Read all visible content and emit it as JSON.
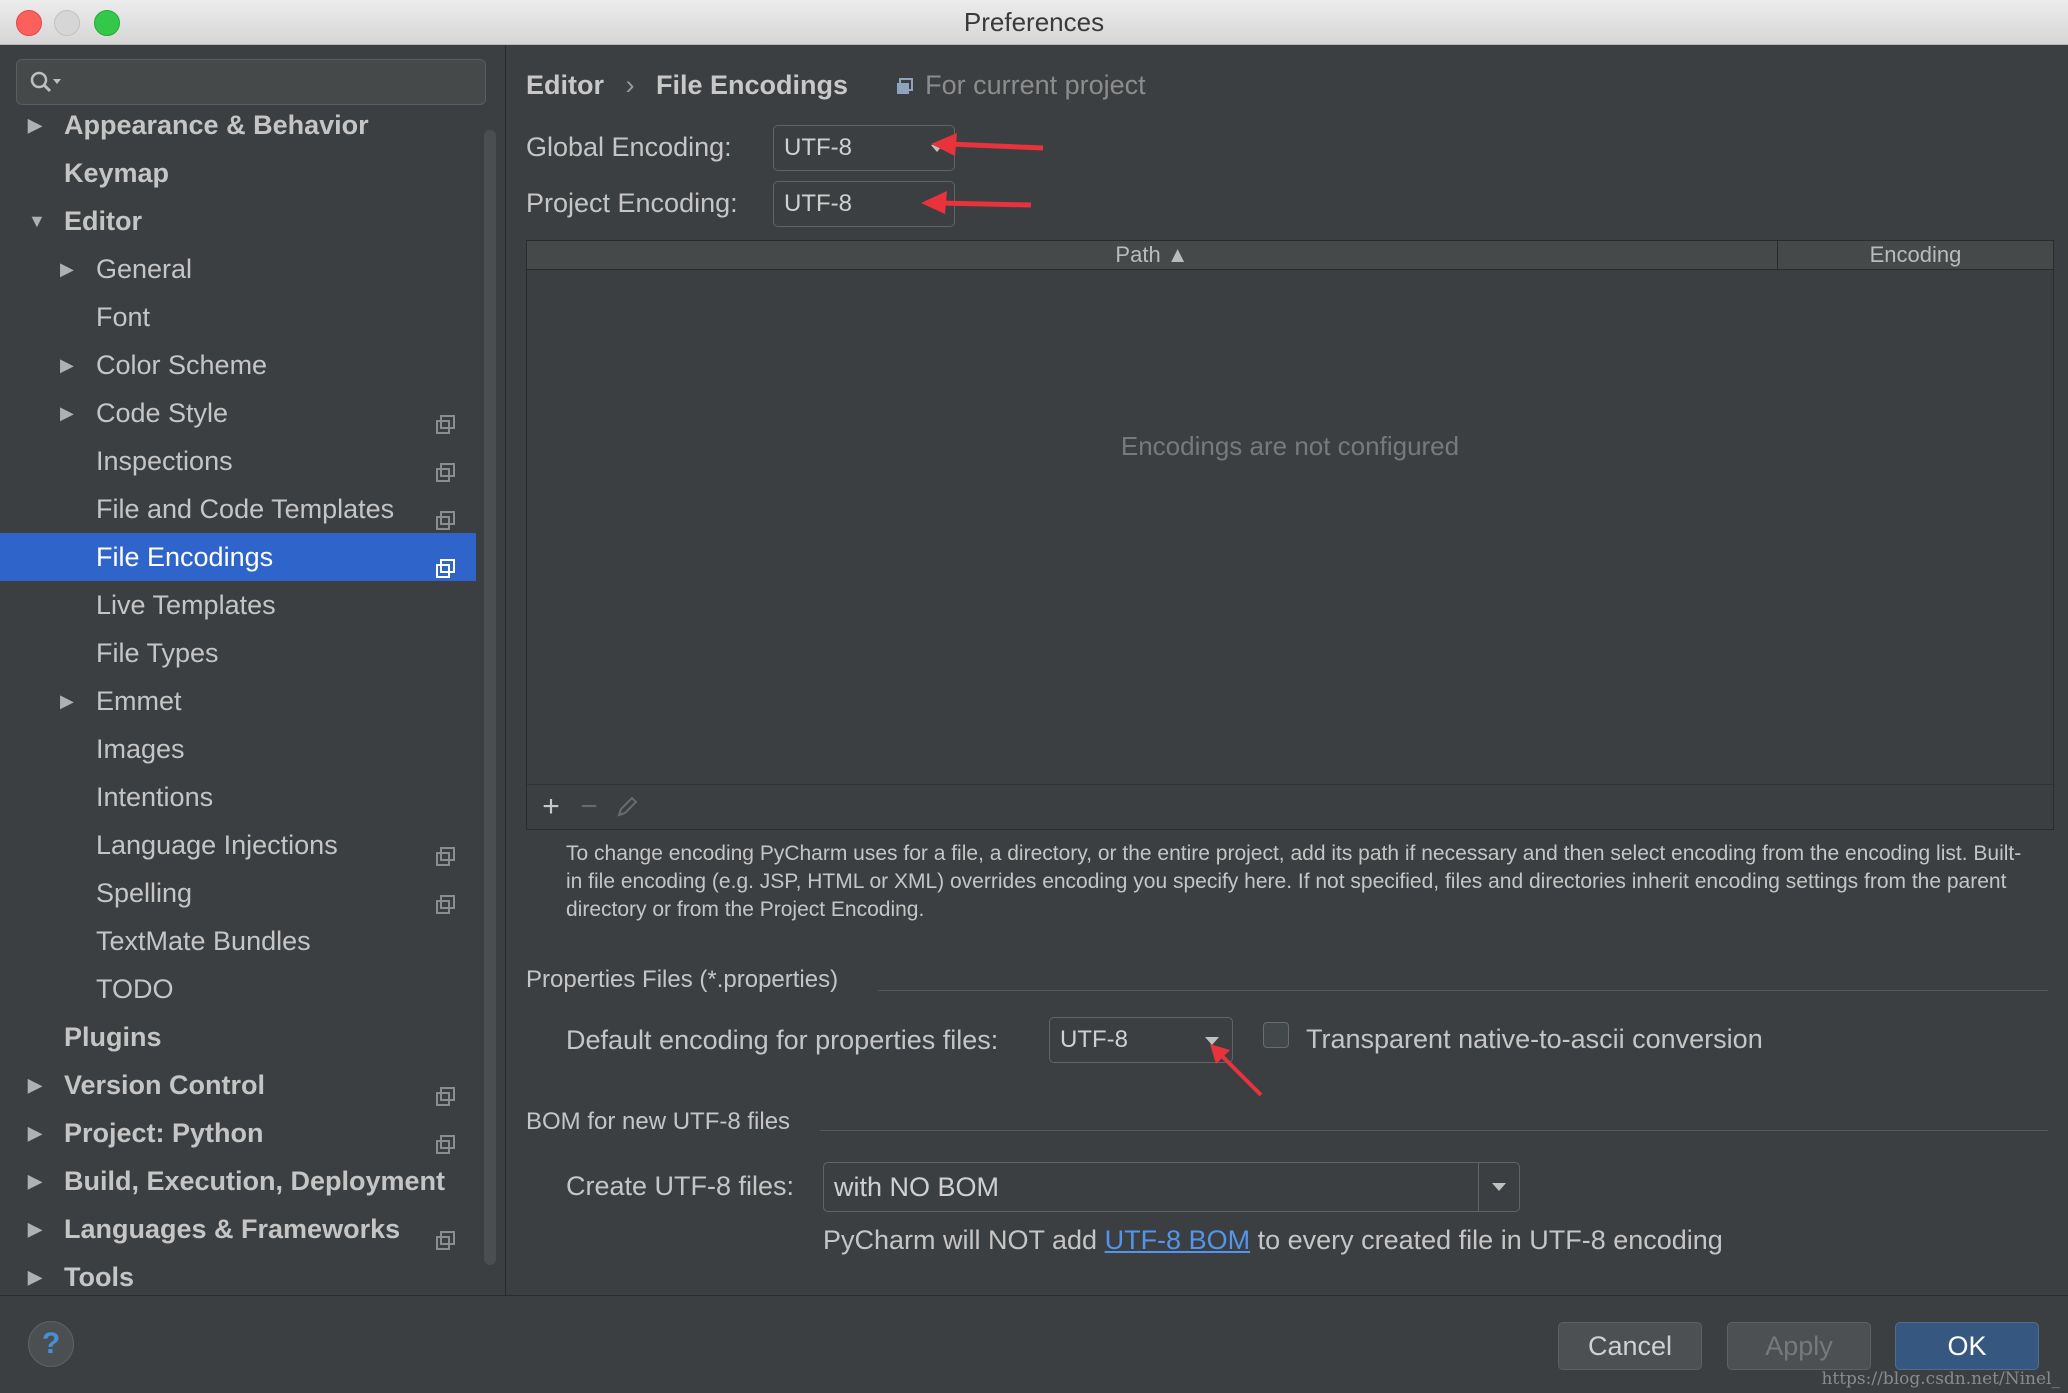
{
  "window": {
    "title": "Preferences"
  },
  "sidebar": {
    "search_placeholder": "",
    "items": [
      {
        "label": "Appearance & Behavior",
        "level": 0,
        "bold": true,
        "arrow": "collapsed",
        "project_icon": false
      },
      {
        "label": "Keymap",
        "level": 0,
        "bold": true,
        "arrow": "none",
        "project_icon": false
      },
      {
        "label": "Editor",
        "level": 0,
        "bold": true,
        "arrow": "expanded",
        "project_icon": false
      },
      {
        "label": "General",
        "level": 1,
        "bold": false,
        "arrow": "collapsed",
        "project_icon": false
      },
      {
        "label": "Font",
        "level": 1,
        "bold": false,
        "arrow": "none",
        "project_icon": false
      },
      {
        "label": "Color Scheme",
        "level": 1,
        "bold": false,
        "arrow": "collapsed",
        "project_icon": false
      },
      {
        "label": "Code Style",
        "level": 1,
        "bold": false,
        "arrow": "collapsed",
        "project_icon": true
      },
      {
        "label": "Inspections",
        "level": 1,
        "bold": false,
        "arrow": "none",
        "project_icon": true
      },
      {
        "label": "File and Code Templates",
        "level": 1,
        "bold": false,
        "arrow": "none",
        "project_icon": true
      },
      {
        "label": "File Encodings",
        "level": 1,
        "bold": false,
        "arrow": "none",
        "project_icon": true,
        "selected": true
      },
      {
        "label": "Live Templates",
        "level": 1,
        "bold": false,
        "arrow": "none",
        "project_icon": false
      },
      {
        "label": "File Types",
        "level": 1,
        "bold": false,
        "arrow": "none",
        "project_icon": false
      },
      {
        "label": "Emmet",
        "level": 1,
        "bold": false,
        "arrow": "collapsed",
        "project_icon": false
      },
      {
        "label": "Images",
        "level": 1,
        "bold": false,
        "arrow": "none",
        "project_icon": false
      },
      {
        "label": "Intentions",
        "level": 1,
        "bold": false,
        "arrow": "none",
        "project_icon": false
      },
      {
        "label": "Language Injections",
        "level": 1,
        "bold": false,
        "arrow": "none",
        "project_icon": true
      },
      {
        "label": "Spelling",
        "level": 1,
        "bold": false,
        "arrow": "none",
        "project_icon": true
      },
      {
        "label": "TextMate Bundles",
        "level": 1,
        "bold": false,
        "arrow": "none",
        "project_icon": false
      },
      {
        "label": "TODO",
        "level": 1,
        "bold": false,
        "arrow": "none",
        "project_icon": false
      },
      {
        "label": "Plugins",
        "level": 0,
        "bold": true,
        "arrow": "none",
        "project_icon": false
      },
      {
        "label": "Version Control",
        "level": 0,
        "bold": true,
        "arrow": "collapsed",
        "project_icon": true
      },
      {
        "label": "Project: Python",
        "level": 0,
        "bold": true,
        "arrow": "collapsed",
        "project_icon": true
      },
      {
        "label": "Build, Execution, Deployment",
        "level": 0,
        "bold": true,
        "arrow": "collapsed",
        "project_icon": false
      },
      {
        "label": "Languages & Frameworks",
        "level": 0,
        "bold": true,
        "arrow": "collapsed",
        "project_icon": true
      },
      {
        "label": "Tools",
        "level": 0,
        "bold": true,
        "arrow": "collapsed",
        "project_icon": false
      }
    ]
  },
  "main": {
    "breadcrumb": {
      "parent": "Editor",
      "separator": "›",
      "current": "File Encodings",
      "scope": "For current project"
    },
    "global_encoding": {
      "label": "Global Encoding:",
      "value": "UTF-8"
    },
    "project_encoding": {
      "label": "Project Encoding:",
      "value": "UTF-8"
    },
    "table": {
      "columns": [
        "Path ▲",
        "Encoding"
      ],
      "empty_text": "Encodings are not configured"
    },
    "help_text": "To change encoding PyCharm uses for a file, a directory, or the entire project, add its path if necessary and then select encoding from the encoding list. Built-in file encoding (e.g. JSP, HTML or XML) overrides encoding you specify here. If not specified, files and directories inherit encoding settings from the parent directory or from the Project Encoding.",
    "properties_section": {
      "title": "Properties Files (*.properties)",
      "default_label": "Default encoding for properties files:",
      "default_value": "UTF-8",
      "checkbox_label": "Transparent native-to-ascii conversion",
      "checkbox_checked": false
    },
    "bom_section": {
      "title": "BOM for new UTF-8 files",
      "create_label": "Create UTF-8 files:",
      "create_value": "with NO BOM",
      "note_prefix": "PyCharm will NOT add ",
      "note_link": "UTF-8 BOM",
      "note_suffix": " to every created file in UTF-8 encoding"
    }
  },
  "footer": {
    "help": "?",
    "cancel": "Cancel",
    "apply": "Apply",
    "ok": "OK",
    "watermark": "https://blog.csdn.net/Ninel_"
  },
  "colors": {
    "background": "#3c3f41",
    "selection": "#2f65ca",
    "link": "#5394ec",
    "annotation_arrow": "#e8323c",
    "ok_button": "#365880"
  }
}
